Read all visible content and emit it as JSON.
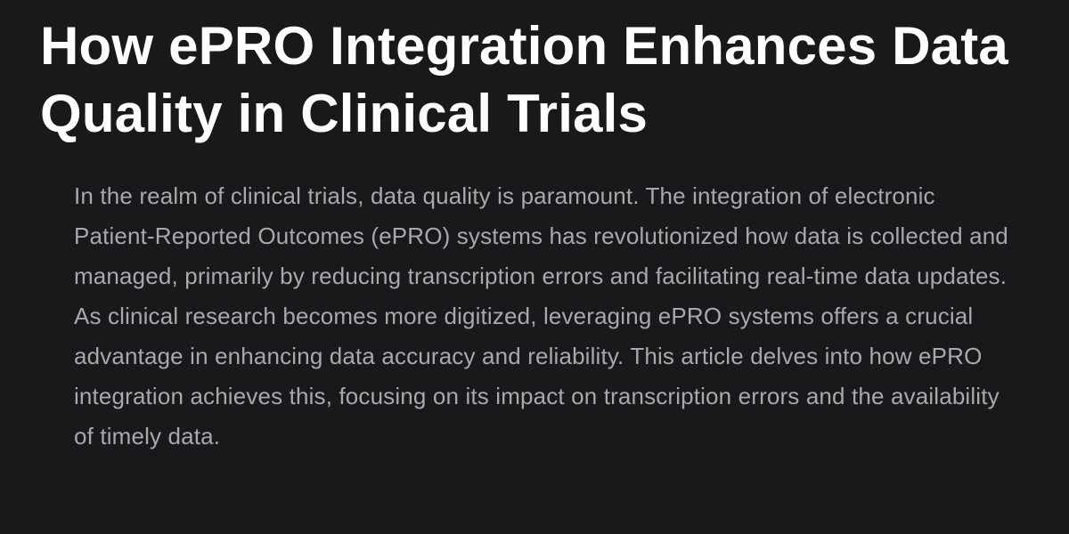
{
  "article": {
    "title": "How ePRO Integration Enhances Data Quality in Clinical Trials",
    "intro": "In the realm of clinical trials, data quality is paramount. The integration of electronic Patient-Reported Outcomes (ePRO) systems has revolutionized how data is collected and managed, primarily by reducing transcription errors and facilitating real-time data updates. As clinical research becomes more digitized, leveraging ePRO systems offers a crucial advantage in enhancing data accuracy and reliability. This article delves into how ePRO integration achieves this, focusing on its impact on transcription errors and the availability of timely data."
  },
  "colors": {
    "background": "#19191b",
    "title": "#ffffff",
    "body_text": "#a8a8ad"
  }
}
